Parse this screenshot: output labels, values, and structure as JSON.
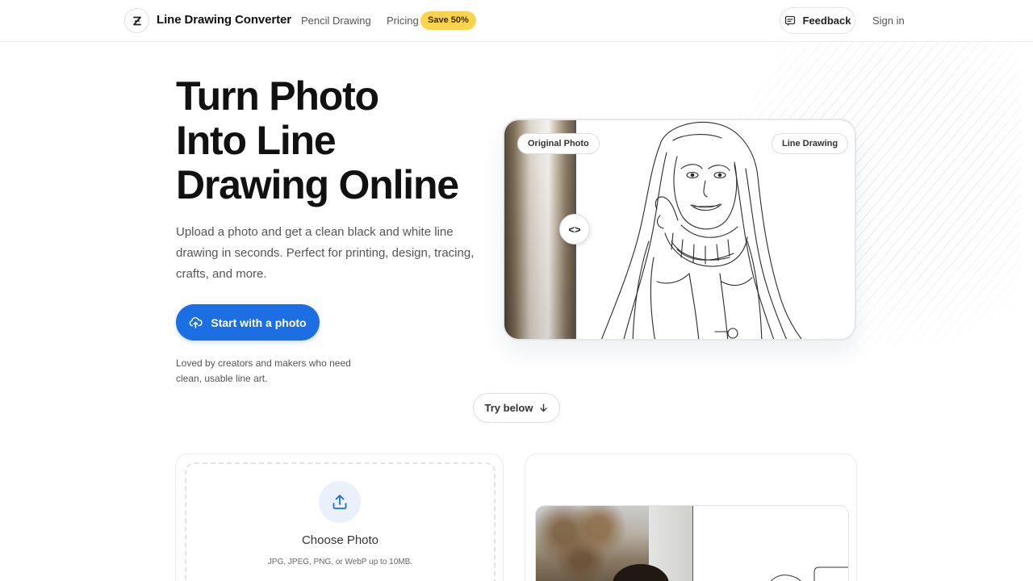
{
  "nav": {
    "brand": "Line Drawing Converter",
    "links": {
      "pencil": "Pencil Drawing",
      "pricing": "Pricing"
    },
    "save_badge": "Save 50%",
    "feedback": "Feedback",
    "signin": "Sign in"
  },
  "hero": {
    "title_lines": [
      "Turn Photo",
      "Into Line",
      "Drawing Online"
    ],
    "subtitle": "Upload a photo and get a clean black and white line drawing in seconds. Perfect for printing, design, tracing, crafts, and more.",
    "cta": "Start with a photo",
    "loved": "Loved by creators and makers who need clean, usable line art."
  },
  "compare": {
    "original_label": "Original Photo",
    "line_label": "Line Drawing",
    "handle": "<>"
  },
  "try_below": "Try below",
  "upload": {
    "title": "Choose Photo",
    "hint": "JPG, JPEG, PNG, or WebP up to 10MB."
  },
  "colors": {
    "primary": "#1b6fe3",
    "badge": "#fcd34d",
    "text": "#111111",
    "muted": "#555555"
  }
}
